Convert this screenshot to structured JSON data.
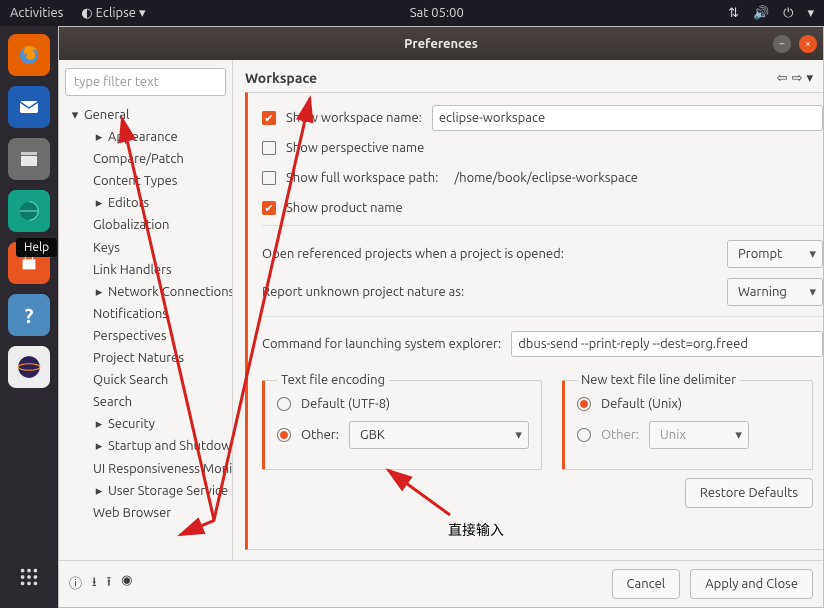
{
  "topbar": {
    "activities": "Activities",
    "app": "Eclipse",
    "clock": "Sat 05:00"
  },
  "window": {
    "title": "Preferences"
  },
  "sidebar": {
    "filter_placeholder": "type filter text",
    "tree": [
      {
        "label": "General",
        "expanded": true,
        "depth": 1,
        "hasArrow": true
      },
      {
        "label": "Appearance",
        "depth": 2,
        "hasArrow": true
      },
      {
        "label": "Compare/Patch",
        "depth": 2
      },
      {
        "label": "Content Types",
        "depth": 2
      },
      {
        "label": "Editors",
        "depth": 2,
        "hasArrow": true
      },
      {
        "label": "Globalization",
        "depth": 2
      },
      {
        "label": "Keys",
        "depth": 2
      },
      {
        "label": "Link Handlers",
        "depth": 2
      },
      {
        "label": "Network Connections",
        "depth": 2,
        "hasArrow": true
      },
      {
        "label": "Notifications",
        "depth": 2
      },
      {
        "label": "Perspectives",
        "depth": 2
      },
      {
        "label": "Project Natures",
        "depth": 2
      },
      {
        "label": "Quick Search",
        "depth": 2
      },
      {
        "label": "Search",
        "depth": 2
      },
      {
        "label": "Security",
        "depth": 2,
        "hasArrow": true
      },
      {
        "label": "Startup and Shutdown",
        "depth": 2,
        "hasArrow": true
      },
      {
        "label": "UI Responsiveness Monitoring",
        "depth": 2
      },
      {
        "label": "User Storage Service",
        "depth": 2,
        "hasArrow": true
      },
      {
        "label": "Web Browser",
        "depth": 2
      }
    ]
  },
  "tooltip": "Help",
  "main": {
    "heading": "Workspace",
    "show_ws_name_label": "Show workspace name:",
    "show_ws_name_checked": true,
    "ws_name_value": "eclipse-workspace",
    "show_perspective_label": "Show perspective name",
    "show_perspective_checked": false,
    "show_full_path_label": "Show full workspace path:",
    "show_full_path_checked": false,
    "full_path_value": "/home/book/eclipse-workspace",
    "show_product_label": "Show product name",
    "show_product_checked": true,
    "open_ref_label": "Open referenced projects when a project is opened:",
    "open_ref_value": "Prompt",
    "report_unknown_label": "Report unknown project nature as:",
    "report_unknown_value": "Warning",
    "system_explorer_label": "Command for launching system explorer:",
    "system_explorer_value": "dbus-send --print-reply --dest=org.freed",
    "encoding": {
      "legend": "Text file encoding",
      "default": "Default (UTF-8)",
      "other": "Other:",
      "other_value": "GBK",
      "selected": "other"
    },
    "delimiter": {
      "legend": "New text file line delimiter",
      "default": "Default (Unix)",
      "other": "Other:",
      "other_value": "Unix",
      "selected": "default"
    },
    "restore": "Restore Defaults"
  },
  "footer": {
    "cancel": "Cancel",
    "apply": "Apply and Close"
  },
  "annotation": "直接输入"
}
